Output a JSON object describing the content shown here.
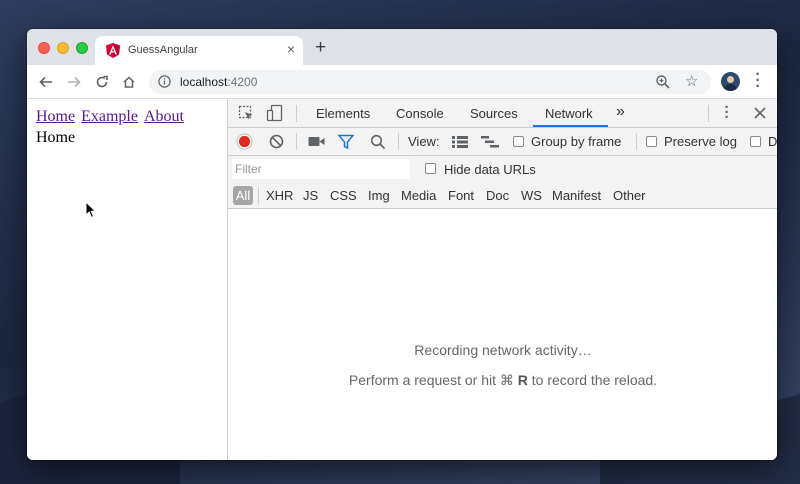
{
  "browser": {
    "tab_title": "GuessAngular",
    "tab_close": "×",
    "new_tab": "+",
    "url_host": "localhost",
    "url_port": ":4200"
  },
  "page": {
    "nav_links": [
      "Home",
      "Example",
      "About"
    ],
    "content": "Home"
  },
  "devtools": {
    "tabs": [
      "Elements",
      "Console",
      "Sources",
      "Network"
    ],
    "overflow": "»",
    "active_tab": "Network",
    "view_label": "View:",
    "group_by_frame": "Group by frame",
    "preserve_log": "Preserve log",
    "truncated_option": "D",
    "filter_placeholder": "Filter",
    "hide_data_urls": "Hide data URLs",
    "types": [
      "All",
      "XHR",
      "JS",
      "CSS",
      "Img",
      "Media",
      "Font",
      "Doc",
      "WS",
      "Manifest",
      "Other"
    ],
    "empty_line1": "Recording network activity…",
    "empty_line2_pre": "Perform a request or hit ⌘ ",
    "empty_line2_key": "R",
    "empty_line2_post": " to record the reload."
  },
  "colors": {
    "record": "#e0281e",
    "accent": "#1a73e8",
    "link": "#551a8b",
    "angular": "#dd0031"
  }
}
